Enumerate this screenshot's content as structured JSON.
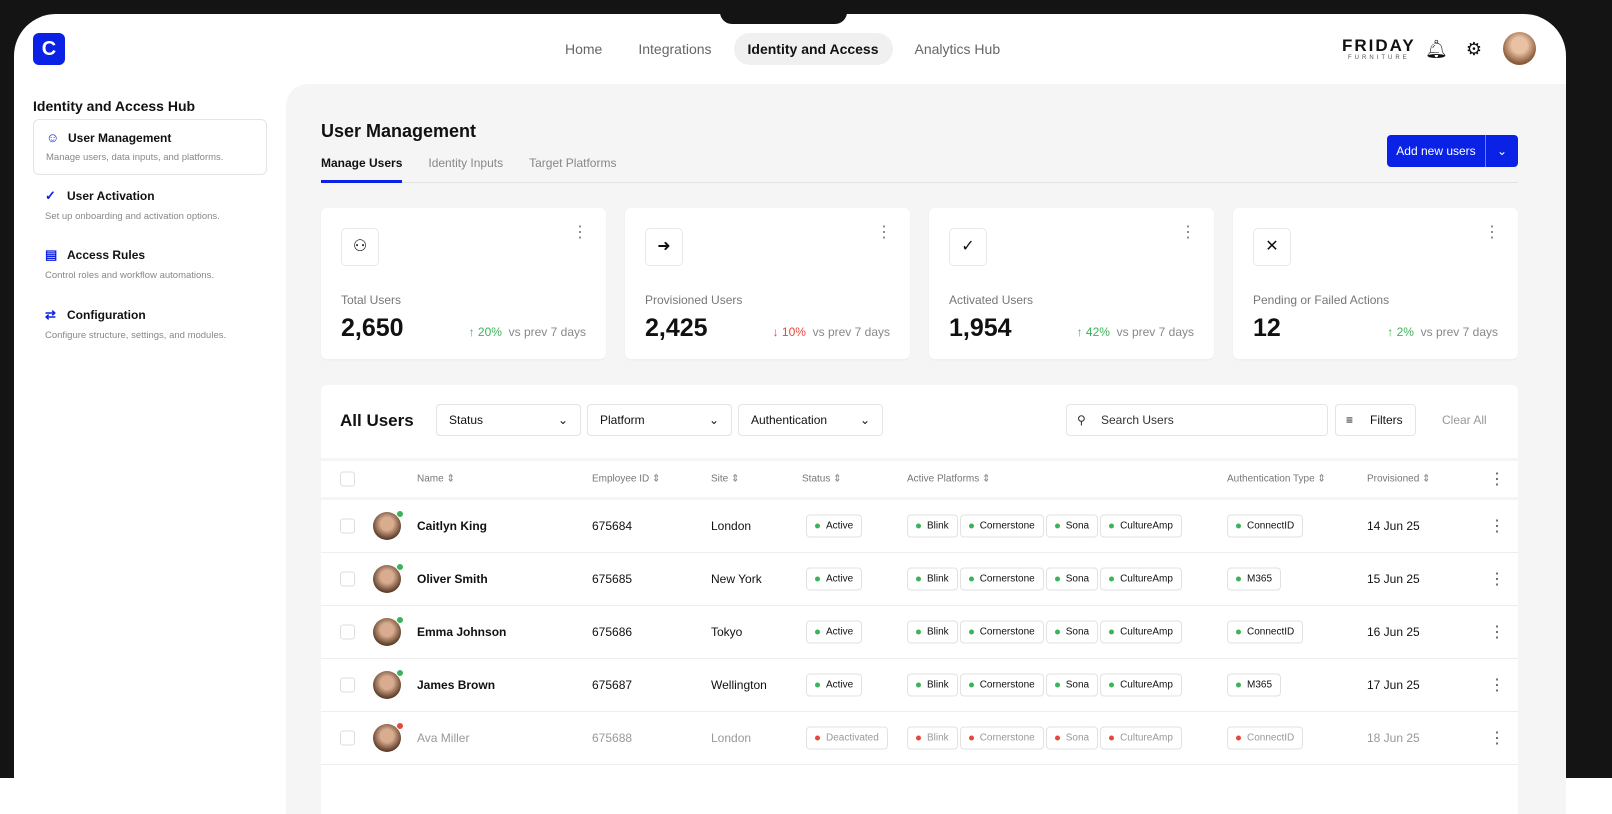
{
  "colors": {
    "accent": "#0a22e6",
    "active": "#3cb35a",
    "deactivated": "#e5483d"
  },
  "topnav": {
    "items": [
      "Home",
      "Integrations",
      "Identity and Access",
      "Analytics Hub"
    ],
    "active": 2
  },
  "brand": {
    "name": "FRIDAY",
    "sub": "FURNITURE"
  },
  "sidebar": {
    "title": "Identity and Access Hub",
    "items": [
      {
        "label": "User Management",
        "desc": "Manage users, data inputs, and platforms.",
        "icon": "user-icon"
      },
      {
        "label": "User Activation",
        "desc": "Set up onboarding and activation options.",
        "icon": "user-check-icon"
      },
      {
        "label": "Access Rules",
        "desc": "Control roles and workflow automations.",
        "icon": "document-rules-icon"
      },
      {
        "label": "Configuration",
        "desc": "Configure structure, settings, and modules.",
        "icon": "sliders-icon"
      }
    ]
  },
  "main": {
    "title": "User Management",
    "tabs": [
      "Manage Users",
      "Identity Inputs",
      "Target Platforms"
    ],
    "add_button": "Add new users"
  },
  "cards": [
    {
      "label": "Total Users",
      "value": "2,650",
      "trend": "up",
      "pct": "20%",
      "cmp": "vs prev 7 days"
    },
    {
      "label": "Provisioned Users",
      "value": "2,425",
      "trend": "down",
      "pct": "10%",
      "cmp": "vs prev 7 days"
    },
    {
      "label": "Activated Users",
      "value": "1,954",
      "trend": "up",
      "pct": "42%",
      "cmp": "vs prev 7 days"
    },
    {
      "label": "Pending or Failed Actions",
      "value": "12",
      "trend": "up",
      "pct": "2%",
      "cmp": "vs prev 7 days"
    }
  ],
  "table": {
    "title": "All Users",
    "filters": [
      "Status",
      "Platform",
      "Authentication"
    ],
    "search_placeholder": "Search Users",
    "filters_label": "Filters",
    "clear_label": "Clear All",
    "columns": [
      "Name",
      "Employee ID",
      "Site",
      "Status",
      "Active Platforms",
      "Authentication Type",
      "Provisioned"
    ],
    "rows": [
      {
        "name": "Caitlyn King",
        "id": "675684",
        "site": "London",
        "status": "Active",
        "platforms": [
          "Blink",
          "Cornerstone",
          "Sona",
          "CultureAmp"
        ],
        "auth": "ConnectID",
        "provisioned": "14 Jun 25"
      },
      {
        "name": "Oliver Smith",
        "id": "675685",
        "site": "New York",
        "status": "Active",
        "platforms": [
          "Blink",
          "Cornerstone",
          "Sona",
          "CultureAmp"
        ],
        "auth": "M365",
        "provisioned": "15 Jun 25"
      },
      {
        "name": "Emma Johnson",
        "id": "675686",
        "site": "Tokyo",
        "status": "Active",
        "platforms": [
          "Blink",
          "Cornerstone",
          "Sona",
          "CultureAmp"
        ],
        "auth": "ConnectID",
        "provisioned": "16 Jun 25"
      },
      {
        "name": "James Brown",
        "id": "675687",
        "site": "Wellington",
        "status": "Active",
        "platforms": [
          "Blink",
          "Cornerstone",
          "Sona",
          "CultureAmp"
        ],
        "auth": "M365",
        "provisioned": "17 Jun 25"
      },
      {
        "name": "Ava Miller",
        "id": "675688",
        "site": "London",
        "status": "Deactivated",
        "platforms": [
          "Blink",
          "Cornerstone",
          "Sona",
          "CultureAmp"
        ],
        "auth": "ConnectID",
        "provisioned": "18 Jun 25"
      }
    ]
  }
}
